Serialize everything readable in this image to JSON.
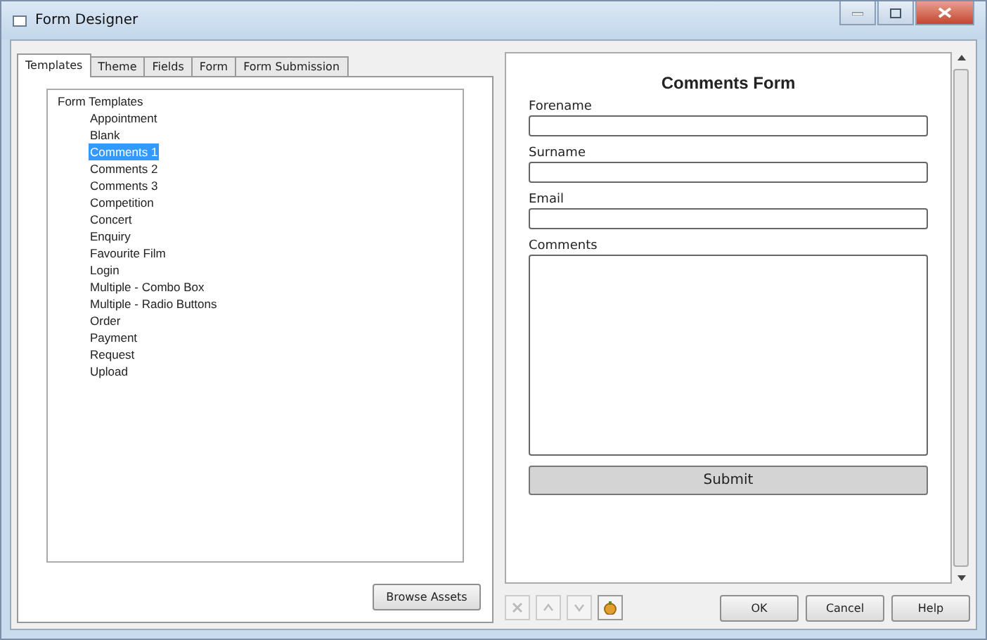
{
  "window": {
    "title": "Form Designer"
  },
  "tabs": [
    {
      "label": "Templates",
      "selected": true
    },
    {
      "label": "Theme",
      "selected": false
    },
    {
      "label": "Fields",
      "selected": false
    },
    {
      "label": "Form",
      "selected": false
    },
    {
      "label": "Form Submission",
      "selected": false
    }
  ],
  "tree": [
    {
      "label": "Form Templates",
      "selected": false,
      "children": [
        {
          "label": "Appointment",
          "selected": false
        },
        {
          "label": "Blank",
          "selected": false
        },
        {
          "label": "Comments 1",
          "selected": true
        },
        {
          "label": "Comments 2",
          "selected": false
        },
        {
          "label": "Comments 3",
          "selected": false
        },
        {
          "label": "Competition",
          "selected": false
        },
        {
          "label": "Concert",
          "selected": false
        },
        {
          "label": "Enquiry",
          "selected": false
        },
        {
          "label": "Favourite Film",
          "selected": false
        },
        {
          "label": "Login",
          "selected": false
        },
        {
          "label": "Multiple - Combo Box",
          "selected": false
        },
        {
          "label": "Multiple - Radio Buttons",
          "selected": false
        },
        {
          "label": "Order",
          "selected": false
        },
        {
          "label": "Payment",
          "selected": false
        },
        {
          "label": "Request",
          "selected": false
        },
        {
          "label": "Upload",
          "selected": false
        }
      ]
    }
  ],
  "browse_button": "Browse Assets",
  "preview": {
    "title": "Comments Form",
    "fields": [
      {
        "kind": "text",
        "label": "Forename"
      },
      {
        "kind": "text",
        "label": "Surname"
      },
      {
        "kind": "text",
        "label": "Email"
      },
      {
        "kind": "textarea",
        "label": "Comments"
      }
    ],
    "submit": "Submit"
  },
  "tools": [
    {
      "kind": "delete",
      "disabled": true
    },
    {
      "kind": "up",
      "disabled": true
    },
    {
      "kind": "down",
      "disabled": true
    },
    {
      "kind": "add",
      "disabled": false
    }
  ],
  "buttons": [
    "OK",
    "Cancel",
    "Help"
  ]
}
